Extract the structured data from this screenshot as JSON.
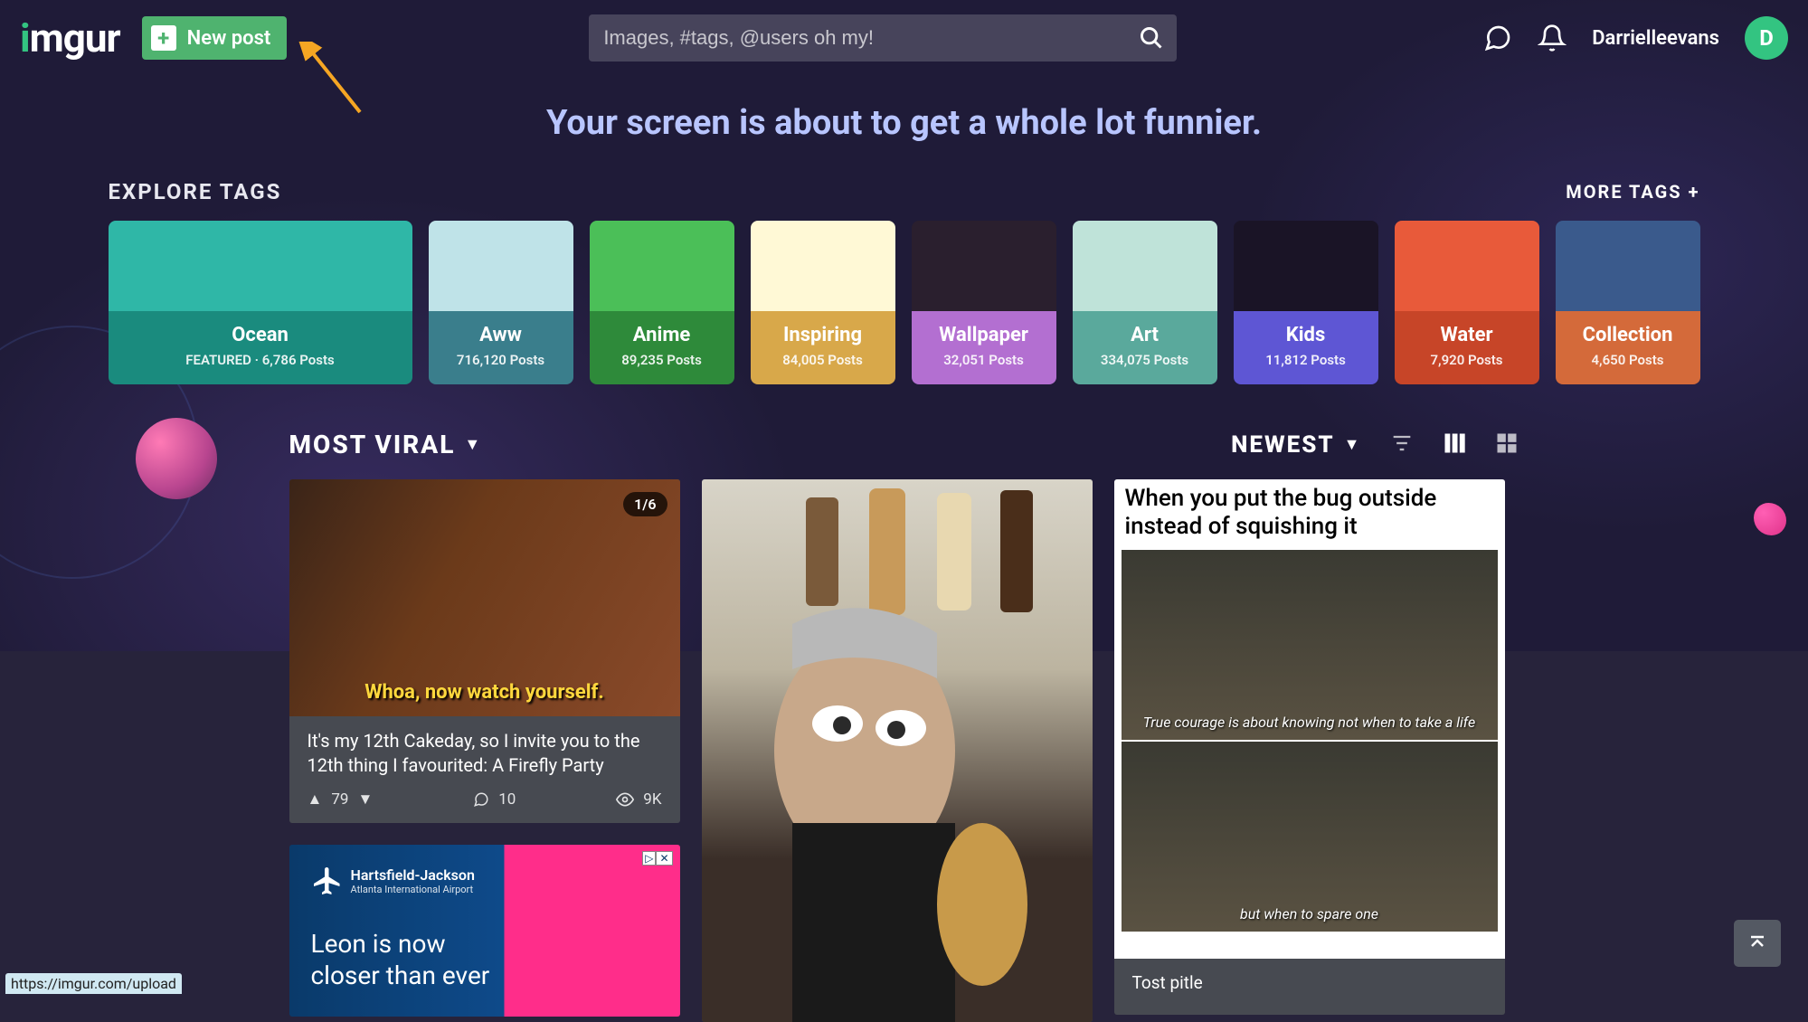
{
  "header": {
    "logo_text": "imgur",
    "new_post_label": "New post",
    "search_placeholder": "Images, #tags, @users oh my!",
    "username": "Darrielleevans",
    "avatar_letter": "D"
  },
  "tagline": "Your screen is about to get a whole lot funnier.",
  "explore": {
    "heading": "EXPLORE TAGS",
    "more_label": "MORE TAGS +",
    "tags": [
      {
        "name": "Ocean",
        "count_label": "FEATURED · 6,786 Posts",
        "bg": "#2fb7a7",
        "bar": "#1a8b7e"
      },
      {
        "name": "Aww",
        "count_label": "716,120 Posts",
        "bg": "#bfe3e8",
        "bar": "#3a7e8c"
      },
      {
        "name": "Anime",
        "count_label": "89,235 Posts",
        "bg": "#4bbf58",
        "bar": "#2e8a3a"
      },
      {
        "name": "Inspiring",
        "count_label": "84,005 Posts",
        "bg": "#fff9d6",
        "bar": "#d8a84a"
      },
      {
        "name": "Wallpaper",
        "count_label": "32,051 Posts",
        "bg": "#2a1f2e",
        "bar": "#b36fd1"
      },
      {
        "name": "Art",
        "count_label": "334,075 Posts",
        "bg": "#bfe3d9",
        "bar": "#5aa99c"
      },
      {
        "name": "Kids",
        "count_label": "11,812 Posts",
        "bg": "#1a1426",
        "bar": "#5e56d4"
      },
      {
        "name": "Water",
        "count_label": "7,920 Posts",
        "bg": "#e85a3a",
        "bar": "#c74528"
      },
      {
        "name": "Collection",
        "count_label": "4,650 Posts",
        "bg": "#3a5a8c",
        "bar": "#d46a3a"
      }
    ]
  },
  "content": {
    "sort_primary": "MOST VIRAL",
    "sort_secondary": "NEWEST",
    "post1": {
      "badge": "1/6",
      "caption_overlay": "Whoa, now watch yourself.",
      "title": "It's my 12th Cakeday, so I invite you to the 12th thing I favourited: A Firefly Party",
      "upvotes": "79",
      "comments": "10",
      "views": "9K"
    },
    "post3": {
      "caption_l1": "When you put the bug outside instead of squishing it",
      "caption_l2": "True courage is about knowing not when to take a life",
      "caption_l3": "but when to spare one",
      "title": "Tost pitle"
    },
    "ad": {
      "brand": "Hartsfield-Jackson",
      "brand_sub": "Atlanta International Airport",
      "line1": "Leon is now",
      "line2": "closer than ever"
    }
  },
  "status_url": "https://imgur.com/upload"
}
